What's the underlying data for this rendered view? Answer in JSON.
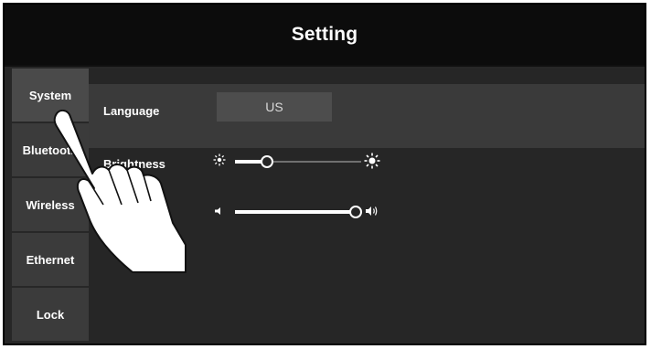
{
  "header": {
    "title": "Setting"
  },
  "sidebar": {
    "tabs": [
      {
        "label": "System",
        "active": true
      },
      {
        "label": "Bluetooth",
        "active": false
      },
      {
        "label": "Wireless",
        "active": false
      },
      {
        "label": "Ethernet",
        "active": false
      },
      {
        "label": "Lock",
        "active": false
      }
    ]
  },
  "system": {
    "language_label": "Language",
    "language_value": "US",
    "brightness_label": "Brightness",
    "brightness_level": 0.25,
    "volume_level": 1.0
  },
  "icons": {
    "brightness_low": "sun-small-icon",
    "brightness_high": "sun-large-icon",
    "volume_low": "speaker-low-icon",
    "volume_high": "speaker-high-icon",
    "pointer": "hand-pointer-icon"
  },
  "colors": {
    "background": "#262626",
    "header": "#0c0c0c",
    "accent": "#ffffff"
  }
}
